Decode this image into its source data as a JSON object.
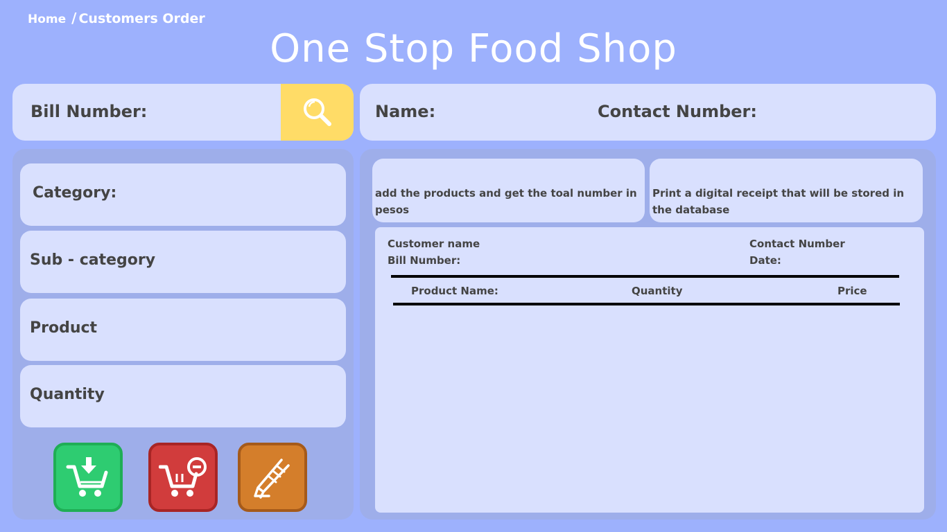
{
  "breadcrumb": {
    "home": "Home",
    "separator": "/",
    "current": "Customers Order"
  },
  "title": "One Stop Food Shop",
  "bill": {
    "label": "Bill Number:",
    "search_icon": "search-icon"
  },
  "customer": {
    "name_label": "Name:",
    "contact_label": "Contact Number:"
  },
  "form": {
    "category": "Category:",
    "sub_category": "Sub - category",
    "product": "Product",
    "quantity": "Quantity"
  },
  "actions": {
    "add_icon": "cart-download-icon",
    "remove_icon": "cart-remove-icon",
    "print_icon": "highlighter-icon"
  },
  "info": {
    "total": "add the products and get the toal number in pesos",
    "receipt": "Print a digital receipt that will be stored in the database"
  },
  "receipt": {
    "customer_name": "Customer name",
    "bill_number": "Bill Number:",
    "contact_number": "Contact Number",
    "date": "Date:",
    "columns": [
      "Product Name:",
      "Quantity",
      "Price"
    ]
  },
  "colors": {
    "background": "#9db1fd",
    "card": "#d9e0fe",
    "panel": "#9eaeea",
    "search": "#ffdc67",
    "add": "#2ecc71",
    "remove": "#d13c3c",
    "print": "#d47e2b"
  }
}
